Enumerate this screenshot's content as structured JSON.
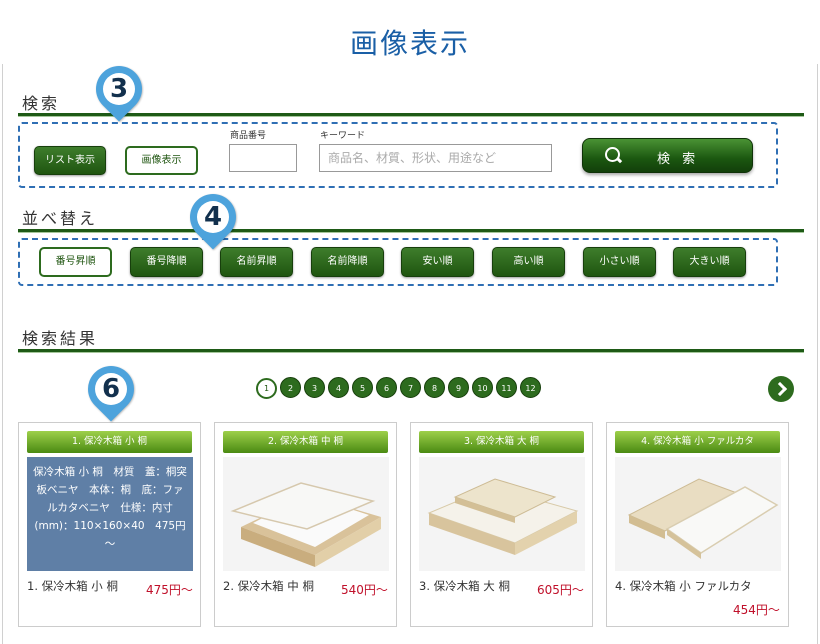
{
  "page_title": "画像表示",
  "markers": {
    "m3": "3",
    "m4": "4",
    "m6": "6"
  },
  "search": {
    "section_title": "検索",
    "list_view_label": "リスト表示",
    "image_view_label": "画像表示",
    "item_no_label": "商品番号",
    "item_no_value": "",
    "keyword_label": "キーワード",
    "keyword_placeholder": "商品名、材質、形状、用途など",
    "search_button_label": "検 索"
  },
  "sort": {
    "section_title": "並べ替え",
    "options": [
      "番号昇順",
      "番号降順",
      "名前昇順",
      "名前降順",
      "安い順",
      "高い順",
      "小さい順",
      "大きい順"
    ]
  },
  "results": {
    "section_title": "検索結果",
    "pages": [
      "1",
      "2",
      "3",
      "4",
      "5",
      "6",
      "7",
      "8",
      "9",
      "10",
      "11",
      "12"
    ],
    "current_page": "1",
    "products": [
      {
        "header": "1. 保冷木箱 小 桐",
        "name": "1. 保冷木箱 小 桐",
        "price": "475円～",
        "hover_text": "保冷木箱 小 桐　材質　蓋：桐突板ベニヤ　本体：桐　底：ファルカタベニヤ　仕様：内寸(mm)：110×160×40　475円～"
      },
      {
        "header": "2. 保冷木箱 中 桐",
        "name": "2. 保冷木箱 中 桐",
        "price": "540円～"
      },
      {
        "header": "3. 保冷木箱 大 桐",
        "name": "3. 保冷木箱 大 桐",
        "price": "605円～"
      },
      {
        "header": "4. 保冷木箱 小 ファルカタ",
        "name": "4. 保冷木箱 小 ファルカタ",
        "price": "454円～"
      }
    ]
  },
  "colors": {
    "accent_green": "#2d6b1e",
    "title_blue": "#1a5fa6",
    "price_red": "#c0102a",
    "marker_blue": "#4da3dc"
  }
}
